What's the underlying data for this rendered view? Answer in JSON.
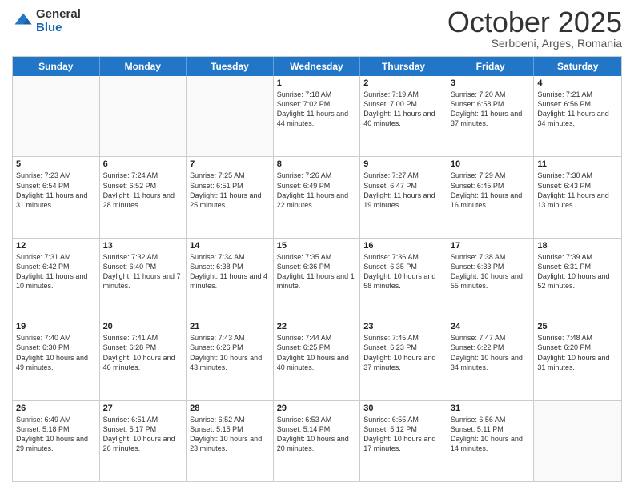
{
  "logo": {
    "general": "General",
    "blue": "Blue"
  },
  "header": {
    "month": "October 2025",
    "location": "Serboeni, Arges, Romania"
  },
  "weekdays": [
    "Sunday",
    "Monday",
    "Tuesday",
    "Wednesday",
    "Thursday",
    "Friday",
    "Saturday"
  ],
  "rows": [
    [
      {
        "day": "",
        "info": ""
      },
      {
        "day": "",
        "info": ""
      },
      {
        "day": "",
        "info": ""
      },
      {
        "day": "1",
        "info": "Sunrise: 7:18 AM\nSunset: 7:02 PM\nDaylight: 11 hours and 44 minutes."
      },
      {
        "day": "2",
        "info": "Sunrise: 7:19 AM\nSunset: 7:00 PM\nDaylight: 11 hours and 40 minutes."
      },
      {
        "day": "3",
        "info": "Sunrise: 7:20 AM\nSunset: 6:58 PM\nDaylight: 11 hours and 37 minutes."
      },
      {
        "day": "4",
        "info": "Sunrise: 7:21 AM\nSunset: 6:56 PM\nDaylight: 11 hours and 34 minutes."
      }
    ],
    [
      {
        "day": "5",
        "info": "Sunrise: 7:23 AM\nSunset: 6:54 PM\nDaylight: 11 hours and 31 minutes."
      },
      {
        "day": "6",
        "info": "Sunrise: 7:24 AM\nSunset: 6:52 PM\nDaylight: 11 hours and 28 minutes."
      },
      {
        "day": "7",
        "info": "Sunrise: 7:25 AM\nSunset: 6:51 PM\nDaylight: 11 hours and 25 minutes."
      },
      {
        "day": "8",
        "info": "Sunrise: 7:26 AM\nSunset: 6:49 PM\nDaylight: 11 hours and 22 minutes."
      },
      {
        "day": "9",
        "info": "Sunrise: 7:27 AM\nSunset: 6:47 PM\nDaylight: 11 hours and 19 minutes."
      },
      {
        "day": "10",
        "info": "Sunrise: 7:29 AM\nSunset: 6:45 PM\nDaylight: 11 hours and 16 minutes."
      },
      {
        "day": "11",
        "info": "Sunrise: 7:30 AM\nSunset: 6:43 PM\nDaylight: 11 hours and 13 minutes."
      }
    ],
    [
      {
        "day": "12",
        "info": "Sunrise: 7:31 AM\nSunset: 6:42 PM\nDaylight: 11 hours and 10 minutes."
      },
      {
        "day": "13",
        "info": "Sunrise: 7:32 AM\nSunset: 6:40 PM\nDaylight: 11 hours and 7 minutes."
      },
      {
        "day": "14",
        "info": "Sunrise: 7:34 AM\nSunset: 6:38 PM\nDaylight: 11 hours and 4 minutes."
      },
      {
        "day": "15",
        "info": "Sunrise: 7:35 AM\nSunset: 6:36 PM\nDaylight: 11 hours and 1 minute."
      },
      {
        "day": "16",
        "info": "Sunrise: 7:36 AM\nSunset: 6:35 PM\nDaylight: 10 hours and 58 minutes."
      },
      {
        "day": "17",
        "info": "Sunrise: 7:38 AM\nSunset: 6:33 PM\nDaylight: 10 hours and 55 minutes."
      },
      {
        "day": "18",
        "info": "Sunrise: 7:39 AM\nSunset: 6:31 PM\nDaylight: 10 hours and 52 minutes."
      }
    ],
    [
      {
        "day": "19",
        "info": "Sunrise: 7:40 AM\nSunset: 6:30 PM\nDaylight: 10 hours and 49 minutes."
      },
      {
        "day": "20",
        "info": "Sunrise: 7:41 AM\nSunset: 6:28 PM\nDaylight: 10 hours and 46 minutes."
      },
      {
        "day": "21",
        "info": "Sunrise: 7:43 AM\nSunset: 6:26 PM\nDaylight: 10 hours and 43 minutes."
      },
      {
        "day": "22",
        "info": "Sunrise: 7:44 AM\nSunset: 6:25 PM\nDaylight: 10 hours and 40 minutes."
      },
      {
        "day": "23",
        "info": "Sunrise: 7:45 AM\nSunset: 6:23 PM\nDaylight: 10 hours and 37 minutes."
      },
      {
        "day": "24",
        "info": "Sunrise: 7:47 AM\nSunset: 6:22 PM\nDaylight: 10 hours and 34 minutes."
      },
      {
        "day": "25",
        "info": "Sunrise: 7:48 AM\nSunset: 6:20 PM\nDaylight: 10 hours and 31 minutes."
      }
    ],
    [
      {
        "day": "26",
        "info": "Sunrise: 6:49 AM\nSunset: 5:18 PM\nDaylight: 10 hours and 29 minutes."
      },
      {
        "day": "27",
        "info": "Sunrise: 6:51 AM\nSunset: 5:17 PM\nDaylight: 10 hours and 26 minutes."
      },
      {
        "day": "28",
        "info": "Sunrise: 6:52 AM\nSunset: 5:15 PM\nDaylight: 10 hours and 23 minutes."
      },
      {
        "day": "29",
        "info": "Sunrise: 6:53 AM\nSunset: 5:14 PM\nDaylight: 10 hours and 20 minutes."
      },
      {
        "day": "30",
        "info": "Sunrise: 6:55 AM\nSunset: 5:12 PM\nDaylight: 10 hours and 17 minutes."
      },
      {
        "day": "31",
        "info": "Sunrise: 6:56 AM\nSunset: 5:11 PM\nDaylight: 10 hours and 14 minutes."
      },
      {
        "day": "",
        "info": ""
      }
    ]
  ]
}
